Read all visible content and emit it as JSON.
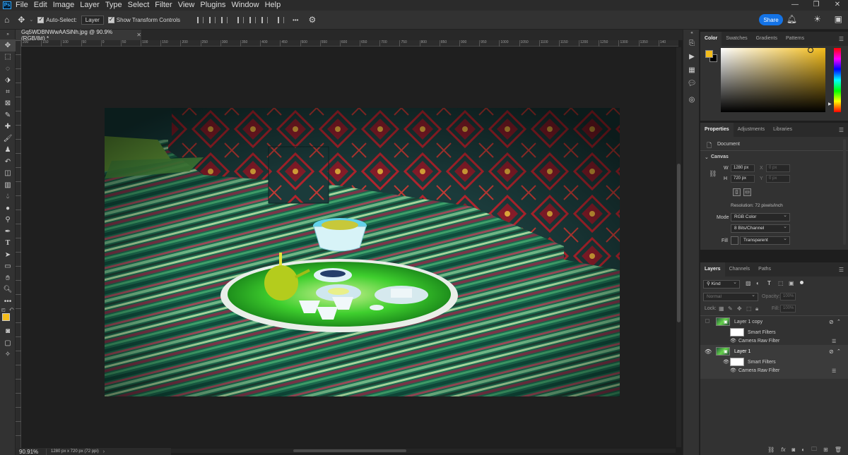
{
  "menu": [
    "File",
    "Edit",
    "Image",
    "Layer",
    "Type",
    "Select",
    "Filter",
    "View",
    "Plugins",
    "Window",
    "Help"
  ],
  "options_bar": {
    "auto_select_label": "Auto-Select:",
    "auto_select_target": "Layer",
    "transform_controls_label": "Show Transform Controls",
    "more_label": "•••",
    "share_label": "Share"
  },
  "document": {
    "tab_title": "Gq5WDBNWwAASiNh.jpg @ 90.9% (RGB/8#) *",
    "zoom": "90.91%",
    "info": "1280 px x 720 px (72 ppi)"
  },
  "ruler": {
    "top_labels": [
      "200",
      "150",
      "100",
      "50",
      "0",
      "50",
      "100",
      "150",
      "200",
      "250",
      "300",
      "350",
      "400",
      "450",
      "500",
      "550",
      "600",
      "650",
      "700",
      "750",
      "800",
      "850",
      "900",
      "950",
      "1000",
      "1050",
      "1100",
      "1150",
      "1200",
      "1250",
      "1300",
      "1350",
      "140"
    ]
  },
  "colors": {
    "foreground": "#f4bd1b",
    "background": "#000000",
    "accent": "#1473e6"
  },
  "color_panel": {
    "tabs": [
      "Color",
      "Swatches",
      "Gradients",
      "Patterns"
    ]
  },
  "properties_panel": {
    "tabs": [
      "Properties",
      "Adjustments",
      "Libraries"
    ],
    "doc_label": "Document",
    "canvas_label": "Canvas",
    "w_label": "W",
    "w_value": "1280 px",
    "h_label": "H",
    "h_value": "720 px",
    "x_label": "X",
    "x_value": "0 px",
    "y_label": "Y",
    "y_value": "0 px",
    "resolution": "Resolution: 72 pixels/inch",
    "mode_label": "Mode",
    "mode_value": "RGB Color",
    "bits_value": "8 Bits/Channel",
    "fill_label": "Fill",
    "fill_value": "Transparent"
  },
  "layers_panel": {
    "tabs": [
      "Layers",
      "Channels",
      "Paths"
    ],
    "kind_label": "Kind",
    "blend_mode": "Normal",
    "opacity_label": "Opacity:",
    "opacity_value": "100%",
    "lock_label": "Lock:",
    "fill_label": "Fill:",
    "fill_value": "100%",
    "layers": [
      {
        "name": "Layer 1 copy",
        "visible": false,
        "smart_filters": "Smart Filters",
        "filter": "Camera Raw Filter"
      },
      {
        "name": "Layer 1",
        "visible": true,
        "smart_filters": "Smart Filters",
        "filter": "Camera Raw Filter"
      }
    ]
  }
}
